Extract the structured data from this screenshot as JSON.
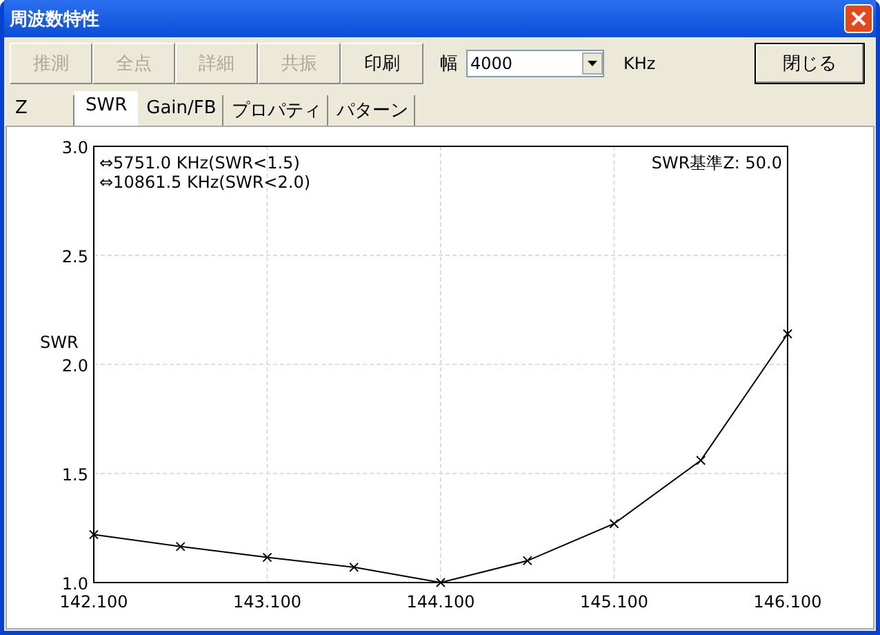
{
  "window": {
    "title": "周波数特性"
  },
  "toolbar": {
    "buttons": [
      {
        "label": "推測",
        "disabled": true
      },
      {
        "label": "全点",
        "disabled": true
      },
      {
        "label": "詳細",
        "disabled": true
      },
      {
        "label": "共振",
        "disabled": true
      },
      {
        "label": "印刷",
        "disabled": false
      }
    ],
    "width_label": "幅",
    "width_value": "4000",
    "width_unit": "KHz",
    "close_button": "閉じる"
  },
  "tabs": [
    {
      "label": "Z",
      "selected": false
    },
    {
      "label": "SWR",
      "selected": true
    },
    {
      "label": "Gain/FB",
      "selected": false
    },
    {
      "label": "プロパティ",
      "selected": false
    },
    {
      "label": "パターン",
      "selected": false
    }
  ],
  "swr_panel": {
    "reference_impedance": "SWR基準Z: 50.0",
    "chart_data": {
      "type": "line",
      "ylabel": "SWR",
      "x": [
        142.1,
        142.6,
        143.1,
        143.6,
        144.1,
        144.6,
        145.1,
        145.6,
        146.1
      ],
      "grid": true,
      "series": [
        {
          "marker": "x",
          "color": "#000000",
          "values": [
            1.22,
            1.165,
            1.115,
            1.07,
            1.0,
            1.1,
            1.27,
            1.56,
            2.14
          ]
        }
      ],
      "xlim": [
        142.1,
        146.1
      ],
      "ylim": [
        1.0,
        3.0
      ],
      "xticks": [
        {
          "value": 142.1,
          "label": "142.100"
        },
        {
          "value": 143.1,
          "label": "143.100"
        },
        {
          "value": 144.1,
          "label": "144.100"
        },
        {
          "value": 145.1,
          "label": "145.100"
        },
        {
          "value": 146.1,
          "label": "146.100"
        }
      ],
      "yticks": [
        {
          "value": 1.0,
          "label": "1.0"
        },
        {
          "value": 1.5,
          "label": "1.5"
        },
        {
          "value": 2.0,
          "label": "2.0"
        },
        {
          "value": 2.5,
          "label": "2.5"
        },
        {
          "value": 3.0,
          "label": "3.0"
        }
      ],
      "annotations": [
        "⇔5751.0 KHz(SWR<1.5)",
        "⇔10861.5 KHz(SWR<2.0)"
      ]
    }
  }
}
